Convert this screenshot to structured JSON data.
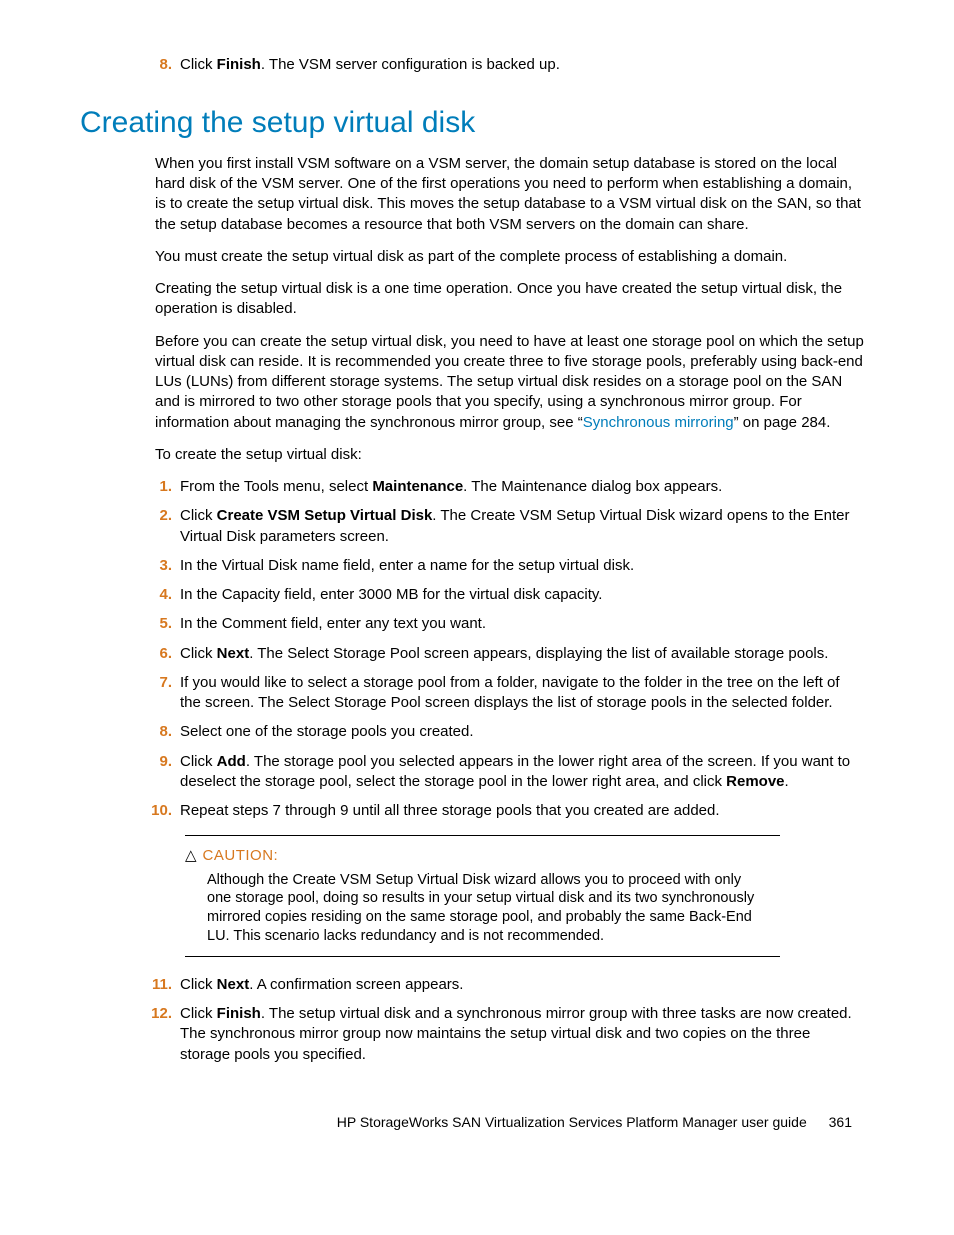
{
  "top_item": {
    "num": "8.",
    "text_a": "Click ",
    "bold": "Finish",
    "text_b": ". The VSM server configuration is backed up."
  },
  "heading": "Creating the setup virtual disk",
  "paras": {
    "p1": "When you first install VSM software on a VSM server, the domain setup database is stored on the local hard disk of the VSM server. One of the first operations you need to perform when establishing a domain, is to create the setup virtual disk. This moves the setup database to a VSM virtual disk on the SAN, so that the setup database becomes a resource that both VSM servers on the domain can share.",
    "p2": "You must create the setup virtual disk as part of the complete process of establishing a domain.",
    "p3": "Creating the setup virtual disk is a one time operation. Once you have created the setup virtual disk, the operation is disabled.",
    "p4a": "Before you can create the setup virtual disk, you need to have at least one storage pool on which the setup virtual disk can reside. It is recommended you create three to five storage pools, preferably using back-end LUs (LUNs) from different storage systems. The setup virtual disk resides on a storage pool on the SAN and is mirrored to two other storage pools that you specify, using a synchronous mirror group. For information about managing the synchronous mirror group, see “",
    "p4link": "Synchronous mirroring",
    "p4b": "” on page 284.",
    "p5": "To create the setup virtual disk:"
  },
  "steps": [
    {
      "num": "1.",
      "segs": [
        {
          "t": "From the Tools menu, select "
        },
        {
          "b": "Maintenance"
        },
        {
          "t": ". The Maintenance dialog box appears."
        }
      ]
    },
    {
      "num": "2.",
      "segs": [
        {
          "t": "Click "
        },
        {
          "b": "Create VSM Setup Virtual Disk"
        },
        {
          "t": ". The Create VSM Setup Virtual Disk wizard opens to the Enter Virtual Disk parameters screen."
        }
      ]
    },
    {
      "num": "3.",
      "segs": [
        {
          "t": "In the Virtual Disk name field, enter a name for the setup virtual disk."
        }
      ]
    },
    {
      "num": "4.",
      "segs": [
        {
          "t": "In the Capacity field, enter 3000 MB for the virtual disk capacity."
        }
      ]
    },
    {
      "num": "5.",
      "segs": [
        {
          "t": "In the Comment field, enter any text you want."
        }
      ]
    },
    {
      "num": "6.",
      "segs": [
        {
          "t": "Click "
        },
        {
          "b": "Next"
        },
        {
          "t": ". The Select Storage Pool screen appears, displaying the list of available storage pools."
        }
      ]
    },
    {
      "num": "7.",
      "segs": [
        {
          "t": "If you would like to select a storage pool from a folder, navigate to the folder in the tree on the left of the screen. The Select Storage Pool screen displays the list of storage pools in the selected folder."
        }
      ]
    },
    {
      "num": "8.",
      "segs": [
        {
          "t": "Select one of the storage pools you created."
        }
      ]
    },
    {
      "num": "9.",
      "segs": [
        {
          "t": "Click "
        },
        {
          "b": "Add"
        },
        {
          "t": ". The storage pool you selected appears in the lower right area of the screen. If you want to deselect the storage pool, select the storage pool in the lower right area, and click "
        },
        {
          "b": "Remove"
        },
        {
          "t": "."
        }
      ]
    },
    {
      "num": "10.",
      "segs": [
        {
          "t": "Repeat steps 7 through 9 until all three storage pools that you created are added."
        }
      ]
    }
  ],
  "caution": {
    "label": "CAUTION:",
    "text": "Although the Create VSM Setup Virtual Disk wizard allows you to proceed with only one storage pool, doing so results in your setup virtual disk and its two synchronously mirrored copies residing on the same storage pool, and probably the same Back-End LU. This scenario lacks redundancy and is not recommended."
  },
  "steps2": [
    {
      "num": "11.",
      "segs": [
        {
          "t": "Click "
        },
        {
          "b": "Next"
        },
        {
          "t": ". A confirmation screen appears."
        }
      ]
    },
    {
      "num": "12.",
      "segs": [
        {
          "t": "Click "
        },
        {
          "b": "Finish"
        },
        {
          "t": ". The setup virtual disk and a synchronous mirror group with three tasks are now created. The synchronous mirror group now maintains the setup virtual disk and two copies on the three storage pools you specified."
        }
      ]
    }
  ],
  "footer": {
    "title": "HP StorageWorks SAN Virtualization Services Platform Manager user guide",
    "page": "361"
  }
}
